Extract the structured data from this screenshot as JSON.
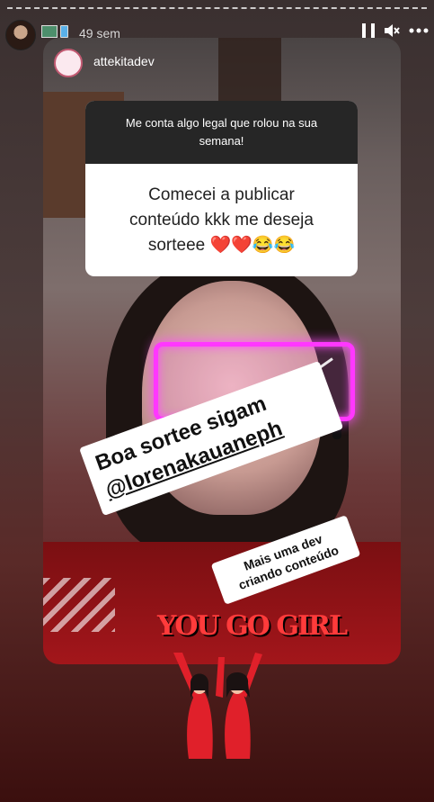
{
  "story": {
    "time_ago": "49 sem",
    "poster_username": "attekitadev",
    "question_prompt": "Me conta algo legal que rolou na sua semana!",
    "question_answer": "Comecei a publicar conteúdo kkk me deseja sorteee ❤️❤️😂😂",
    "sticker_main_line1": "Boa sortee sigam",
    "sticker_main_line2": "@lorenakauaneph",
    "sticker_small": "Mais uma dev criando conteúdo",
    "gif_text": "YOU GO GIRL"
  },
  "icons": {
    "pause": "pause-icon",
    "mute": "mute-icon",
    "more": "more-icon"
  },
  "colors": {
    "glasses_neon": "#ff37ff",
    "question_header_bg": "#262626",
    "gif_text": "#ff3b3b"
  }
}
